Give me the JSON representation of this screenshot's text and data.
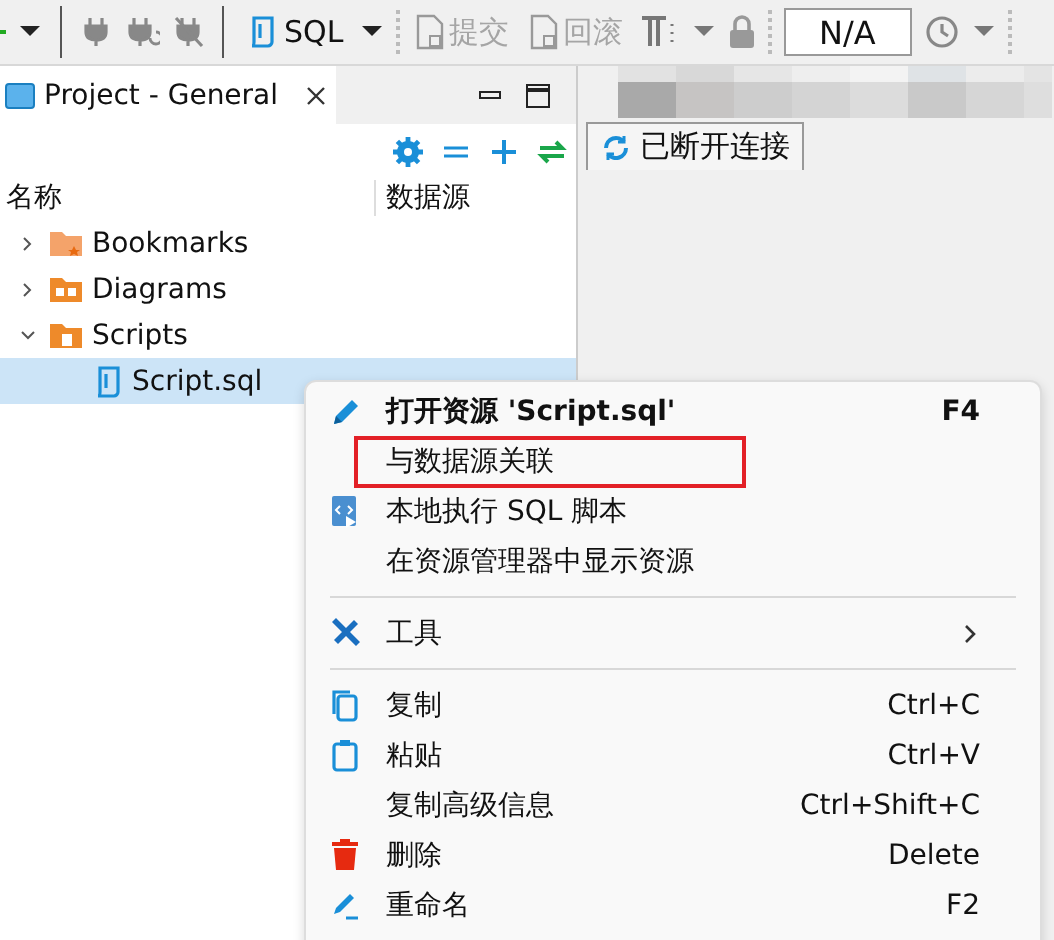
{
  "toolbar": {
    "sql_button": {
      "label": "SQL"
    },
    "commit": {
      "label": "提交",
      "disabled": true
    },
    "rollback": {
      "label": "回滚",
      "disabled": true
    },
    "transaction_field": {
      "value": "N/A"
    }
  },
  "project_panel": {
    "tab": {
      "label": "Project - General"
    },
    "columns": [
      "名称",
      "数据源"
    ],
    "tree": [
      {
        "label": "Bookmarks",
        "expanded": false,
        "selected": false
      },
      {
        "label": "Diagrams",
        "expanded": false,
        "selected": false
      },
      {
        "label": "Scripts",
        "expanded": true,
        "selected": false,
        "children": [
          {
            "label": "Script.sql",
            "selected": true
          }
        ]
      }
    ]
  },
  "editor_area": {
    "tab": {
      "label": "已断开连接"
    }
  },
  "context_menu": [
    {
      "kind": "item",
      "label": "打开资源 'Script.sql'",
      "shortcut": "F4",
      "bold": true,
      "annotated": false
    },
    {
      "kind": "item",
      "label": "与数据源关联",
      "annotated": true
    },
    {
      "kind": "item",
      "label": "本地执行 SQL 脚本",
      "annotated": false
    },
    {
      "kind": "item",
      "label": "在资源管理器中显示资源",
      "annotated": false
    },
    {
      "kind": "separator"
    },
    {
      "kind": "submenu",
      "label": "工具",
      "annotated": false
    },
    {
      "kind": "separator"
    },
    {
      "kind": "item",
      "label": "复制",
      "shortcut": "Ctrl+C",
      "annotated": false
    },
    {
      "kind": "item",
      "label": "粘贴",
      "shortcut": "Ctrl+V",
      "annotated": false
    },
    {
      "kind": "item",
      "label": "复制高级信息",
      "shortcut": "Ctrl+Shift+C",
      "annotated": false
    },
    {
      "kind": "item",
      "label": "删除",
      "shortcut": "Delete",
      "annotated": false
    },
    {
      "kind": "item",
      "label": "重命名",
      "shortcut": "F2",
      "annotated": false
    }
  ]
}
